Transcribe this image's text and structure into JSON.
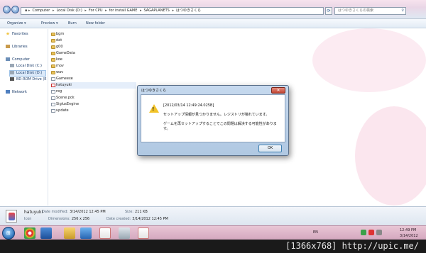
{
  "address": {
    "segments": [
      "Computer",
      "Local Disk (D:)",
      "For CPU",
      "for install GAME",
      "SAGAPLANETS",
      "はつゆきさくら"
    ],
    "search_placeholder": "はつゆきさくらの検索"
  },
  "toolbar": {
    "organize": "Organize ▾",
    "preview": "Preview ▾",
    "burn": "Burn",
    "new_folder": "New folder"
  },
  "sidebar": {
    "favorites": "Favorites",
    "libraries": "Libraries",
    "computer": "Computer",
    "local_c": "Local Disk (C:)",
    "local_d": "Local Disk (D:)",
    "bd_rom": "BD-ROM Drive (E",
    "network": "Network"
  },
  "files": [
    {
      "name": "bgm",
      "type": "folder"
    },
    {
      "name": "dat",
      "type": "folder"
    },
    {
      "name": "g00",
      "type": "folder"
    },
    {
      "name": "GameData",
      "type": "folder"
    },
    {
      "name": "koe",
      "type": "folder"
    },
    {
      "name": "mov",
      "type": "folder"
    },
    {
      "name": "wav",
      "type": "folder"
    },
    {
      "name": "Gameexe",
      "type": "file"
    },
    {
      "name": "hatuyuki",
      "type": "exe"
    },
    {
      "name": "reg",
      "type": "file"
    },
    {
      "name": "Scene.pck",
      "type": "file"
    },
    {
      "name": "SiglusEngine",
      "type": "file"
    },
    {
      "name": "update",
      "type": "file"
    }
  ],
  "dialog": {
    "title": "はつゆきさくら",
    "close": "✕",
    "timestamp": "[2012/03/14 12:49:24.025B]",
    "line1": "セットアップ情報が見つかりません。レジストリが壊れています。",
    "line2": "ゲームを再セットアップすることでこの問題は解決する可能性があります。",
    "ok": "OK"
  },
  "details": {
    "name": "hatuyuki",
    "type": "Icon",
    "modified_label": "Date modified:",
    "modified": "3/14/2012 12:45 PM",
    "size_label": "Size:",
    "size": "211 KB",
    "dims_label": "Dimensions:",
    "dims": "256 x 256",
    "created_label": "Date created:",
    "created": "3/14/2012 12:45 PM"
  },
  "taskbar": {
    "lang": "EN",
    "time": "12:49 PM",
    "date": "3/14/2012"
  },
  "caption": "[1366x768] http://upic.me/"
}
